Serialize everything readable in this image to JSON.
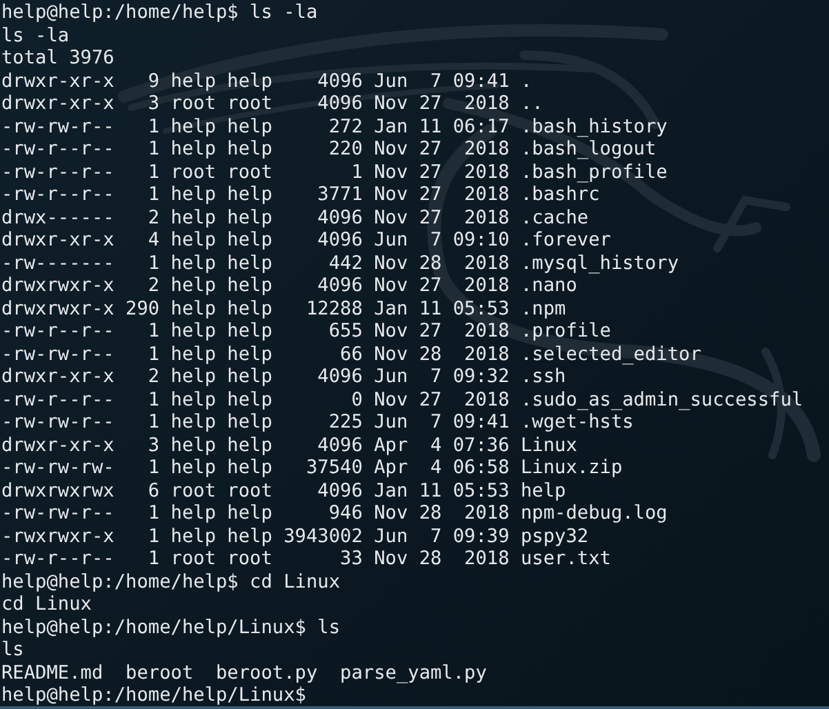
{
  "terminal": {
    "lines": [
      "help@help:/home/help$ ls -la",
      "ls -la",
      "total 3976",
      "drwxr-xr-x   9 help help    4096 Jun  7 09:41 .",
      "drwxr-xr-x   3 root root    4096 Nov 27  2018 ..",
      "-rw-rw-r--   1 help help     272 Jan 11 06:17 .bash_history",
      "-rw-r--r--   1 help help     220 Nov 27  2018 .bash_logout",
      "-rw-r--r--   1 root root       1 Nov 27  2018 .bash_profile",
      "-rw-r--r--   1 help help    3771 Nov 27  2018 .bashrc",
      "drwx------   2 help help    4096 Nov 27  2018 .cache",
      "drwxr-xr-x   4 help help    4096 Jun  7 09:10 .forever",
      "-rw-------   1 help help     442 Nov 28  2018 .mysql_history",
      "drwxrwxr-x   2 help help    4096 Nov 27  2018 .nano",
      "drwxrwxr-x 290 help help   12288 Jan 11 05:53 .npm",
      "-rw-r--r--   1 help help     655 Nov 27  2018 .profile",
      "-rw-rw-r--   1 help help      66 Nov 28  2018 .selected_editor",
      "drwxr-xr-x   2 help help    4096 Jun  7 09:32 .ssh",
      "-rw-r--r--   1 help help       0 Nov 27  2018 .sudo_as_admin_successful",
      "-rw-rw-r--   1 help help     225 Jun  7 09:41 .wget-hsts",
      "drwxr-xr-x   3 help help    4096 Apr  4 07:36 Linux",
      "-rw-rw-rw-   1 help help   37540 Apr  4 06:58 Linux.zip",
      "drwxrwxrwx   6 root root    4096 Jan 11 05:53 help",
      "-rw-rw-r--   1 help help     946 Nov 28  2018 npm-debug.log",
      "-rwxrwxr-x   1 help help 3943002 Jun  7 09:39 pspy32",
      "-rw-r--r--   1 root root      33 Nov 28  2018 user.txt",
      "help@help:/home/help$ cd Linux",
      "cd Linux",
      "help@help:/home/help/Linux$ ls",
      "ls",
      "README.md  beroot  beroot.py  parse_yaml.py",
      "help@help:/home/help/Linux$"
    ]
  }
}
